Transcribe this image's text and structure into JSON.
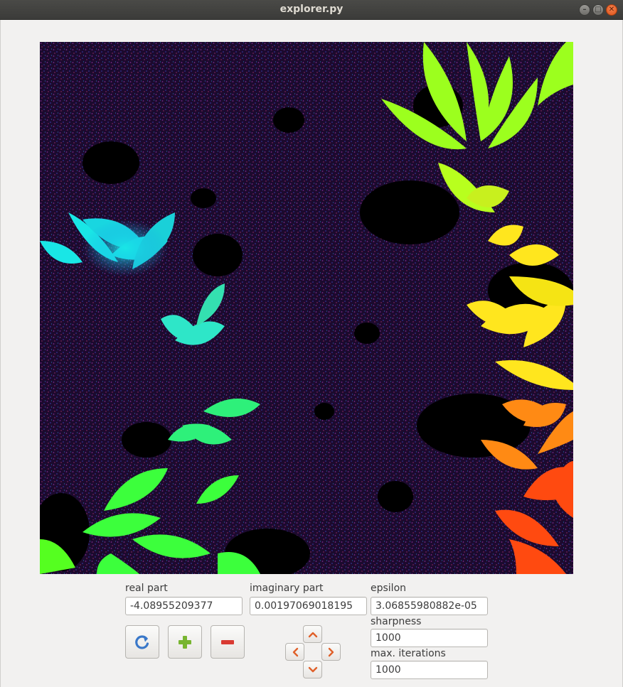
{
  "window": {
    "title": "explorer.py"
  },
  "fields": {
    "real_part": {
      "label": "real part",
      "value": "-4.08955209377"
    },
    "imaginary_part": {
      "label": "imaginary part",
      "value": "0.00197069018195"
    },
    "epsilon": {
      "label": "epsilon",
      "value": "3.06855980882e-05"
    },
    "sharpness": {
      "label": "sharpness",
      "value": "1000"
    },
    "max_iterations": {
      "label": "max. iterations",
      "value": "1000"
    }
  },
  "buttons": {
    "refresh": {
      "icon": "refresh-icon",
      "color": "#3a78c9"
    },
    "zoom_in": {
      "icon": "plus-icon",
      "color": "#78b530"
    },
    "zoom_out": {
      "icon": "minus-icon",
      "color": "#d93a32"
    },
    "pan_up": {
      "icon": "chevron-up-icon",
      "color": "#e0602a"
    },
    "pan_left": {
      "icon": "chevron-left-icon",
      "color": "#e0602a"
    },
    "pan_right": {
      "icon": "chevron-right-icon",
      "color": "#e0602a"
    },
    "pan_down": {
      "icon": "chevron-down-icon",
      "color": "#e0602a"
    }
  },
  "fractal_colors": {
    "background": "#14061f",
    "cyan": "#19e6e6",
    "green": "#3cff3c",
    "lime": "#9cff1e",
    "yellow": "#ffe61e",
    "orange": "#ff8a14",
    "red": "#ff4a10"
  }
}
